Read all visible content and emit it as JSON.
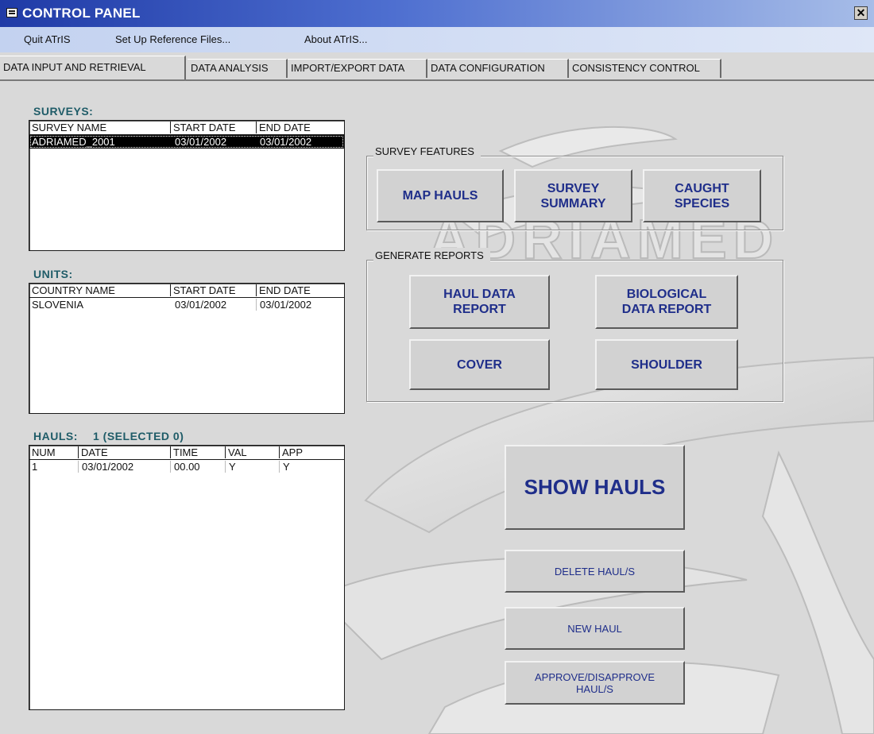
{
  "window": {
    "title": "CONTROL PANEL",
    "close_glyph": "✕"
  },
  "menu": [
    "Quit ATrIS",
    "Set Up Reference Files...",
    "About ATrIS..."
  ],
  "tabs": [
    {
      "label": "DATA INPUT AND RETRIEVAL",
      "active": true
    },
    {
      "label": "DATA ANALYSIS",
      "active": false
    },
    {
      "label": "IMPORT/EXPORT DATA",
      "active": false
    },
    {
      "label": "DATA CONFIGURATION",
      "active": false
    },
    {
      "label": "CONSISTENCY CONTROL",
      "active": false
    }
  ],
  "watermark_text": "ADRIAMED",
  "surveys": {
    "label": "SURVEYS:",
    "columns": [
      "SURVEY NAME",
      "START DATE",
      "END DATE"
    ],
    "rows": [
      [
        "ADRIAMED_2001",
        "03/01/2002",
        "03/01/2002"
      ]
    ]
  },
  "units": {
    "label": "UNITS:",
    "columns": [
      "COUNTRY NAME",
      "START DATE",
      "END DATE"
    ],
    "rows": [
      [
        "SLOVENIA",
        "03/01/2002",
        "03/01/2002"
      ]
    ]
  },
  "hauls": {
    "label": "HAULS:",
    "count_text": "1 (SELECTED 0)",
    "columns": [
      "NUM",
      "DATE",
      "TIME",
      "VAL",
      "APP"
    ],
    "rows": [
      [
        "1",
        "03/01/2002",
        "00.00",
        "Y",
        "Y"
      ]
    ]
  },
  "survey_features": {
    "label": "SURVEY FEATURES",
    "buttons": {
      "map_hauls": "MAP HAULS",
      "survey_summary": "SURVEY\nSUMMARY",
      "caught_species": "CAUGHT\nSPECIES"
    }
  },
  "generate_reports": {
    "label": "GENERATE REPORTS",
    "buttons": {
      "haul_data_report": "HAUL DATA\nREPORT",
      "biological_data_report": "BIOLOGICAL\nDATA REPORT",
      "cover": "COVER",
      "shoulder": "SHOULDER"
    }
  },
  "actions": {
    "show_hauls": "SHOW HAULS",
    "delete_hauls": "DELETE HAUL/S",
    "new_haul": "NEW HAUL",
    "approve_disapprove": "APPROVE/DISAPPROVE\nHAUL/S"
  },
  "colors": {
    "titlebar": "#1f3aa6",
    "section_label": "#1f5c68",
    "button_text": "#1f2e8a"
  }
}
